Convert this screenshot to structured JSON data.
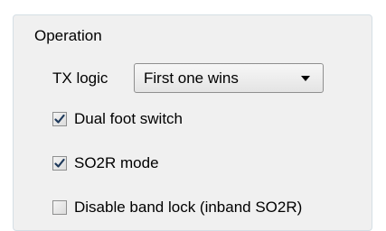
{
  "group": {
    "title": "Operation"
  },
  "tx_logic": {
    "label": "TX logic",
    "selected": "First one wins"
  },
  "options": [
    {
      "label": "Dual foot switch",
      "checked": true
    },
    {
      "label": "SO2R mode",
      "checked": true
    },
    {
      "label": "Disable band lock (inband SO2R)",
      "checked": false
    }
  ],
  "colors": {
    "panel_bg": "#f0f0f0",
    "check_mark": "#1e395b"
  },
  "icons": {
    "combo_arrow": "chevron-down-icon",
    "check": "checkmark-icon"
  }
}
